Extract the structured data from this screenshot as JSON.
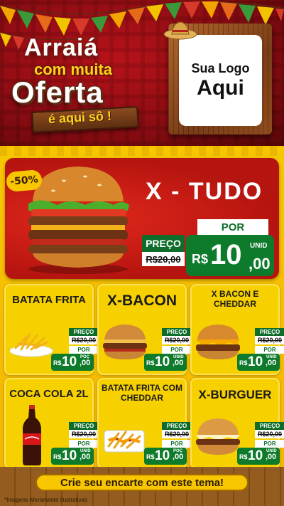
{
  "header": {
    "title_line1": "Arraiá",
    "title_line2": "com muita",
    "title_line3": "Oferta",
    "sign_text": "é aqui sô !"
  },
  "logo": {
    "line1": "Sua Logo",
    "line2": "Aqui"
  },
  "featured": {
    "badge": "-50%",
    "name": "X - TUDO",
    "preco_label": "PREÇO",
    "old_price": "R$20,00",
    "por_label": "POR",
    "currency": "R$",
    "price_int": "10",
    "price_dec": ",00",
    "unit": "UNID"
  },
  "products": [
    {
      "name": "BATATA FRITA",
      "preco_label": "PREÇO",
      "old_price": "R$20,00",
      "por_label": "POR",
      "currency": "R$",
      "price_int": "10",
      "price_dec": ",00",
      "unit": "POÇ"
    },
    {
      "name": "X-BACON",
      "preco_label": "PREÇO",
      "old_price": "R$20,00",
      "por_label": "POR",
      "currency": "R$",
      "price_int": "10",
      "price_dec": ",00",
      "unit": "UNID"
    },
    {
      "name": "X BACON E CHEDDAR",
      "preco_label": "PREÇO",
      "old_price": "R$20,00",
      "por_label": "POR",
      "currency": "R$",
      "price_int": "10",
      "price_dec": ",00",
      "unit": "UNID"
    },
    {
      "name": "COCA COLA 2L",
      "preco_label": "PREÇO",
      "old_price": "R$20,00",
      "por_label": "POR",
      "currency": "R$",
      "price_int": "10",
      "price_dec": ",00",
      "unit": "UNID"
    },
    {
      "name": "BATATA FRITA COM CHEDDAR",
      "preco_label": "PREÇO",
      "old_price": "R$20,00",
      "por_label": "POR",
      "currency": "R$",
      "price_int": "10",
      "price_dec": ",00",
      "unit": "POÇ"
    },
    {
      "name": "X-BURGUER",
      "preco_label": "PREÇO",
      "old_price": "R$20,00",
      "por_label": "POR",
      "currency": "R$",
      "price_int": "10",
      "price_dec": ",00",
      "unit": "UNID"
    }
  ],
  "footer": {
    "cta": "Crie seu encarte com este tema!",
    "disclaimer": "*Imagens Meramente Ilustrativas"
  },
  "colors": {
    "header_red": "#b8121a",
    "main_yellow": "#f6c700",
    "price_green": "#0e7a2c",
    "featured_red": "#d3221a"
  }
}
